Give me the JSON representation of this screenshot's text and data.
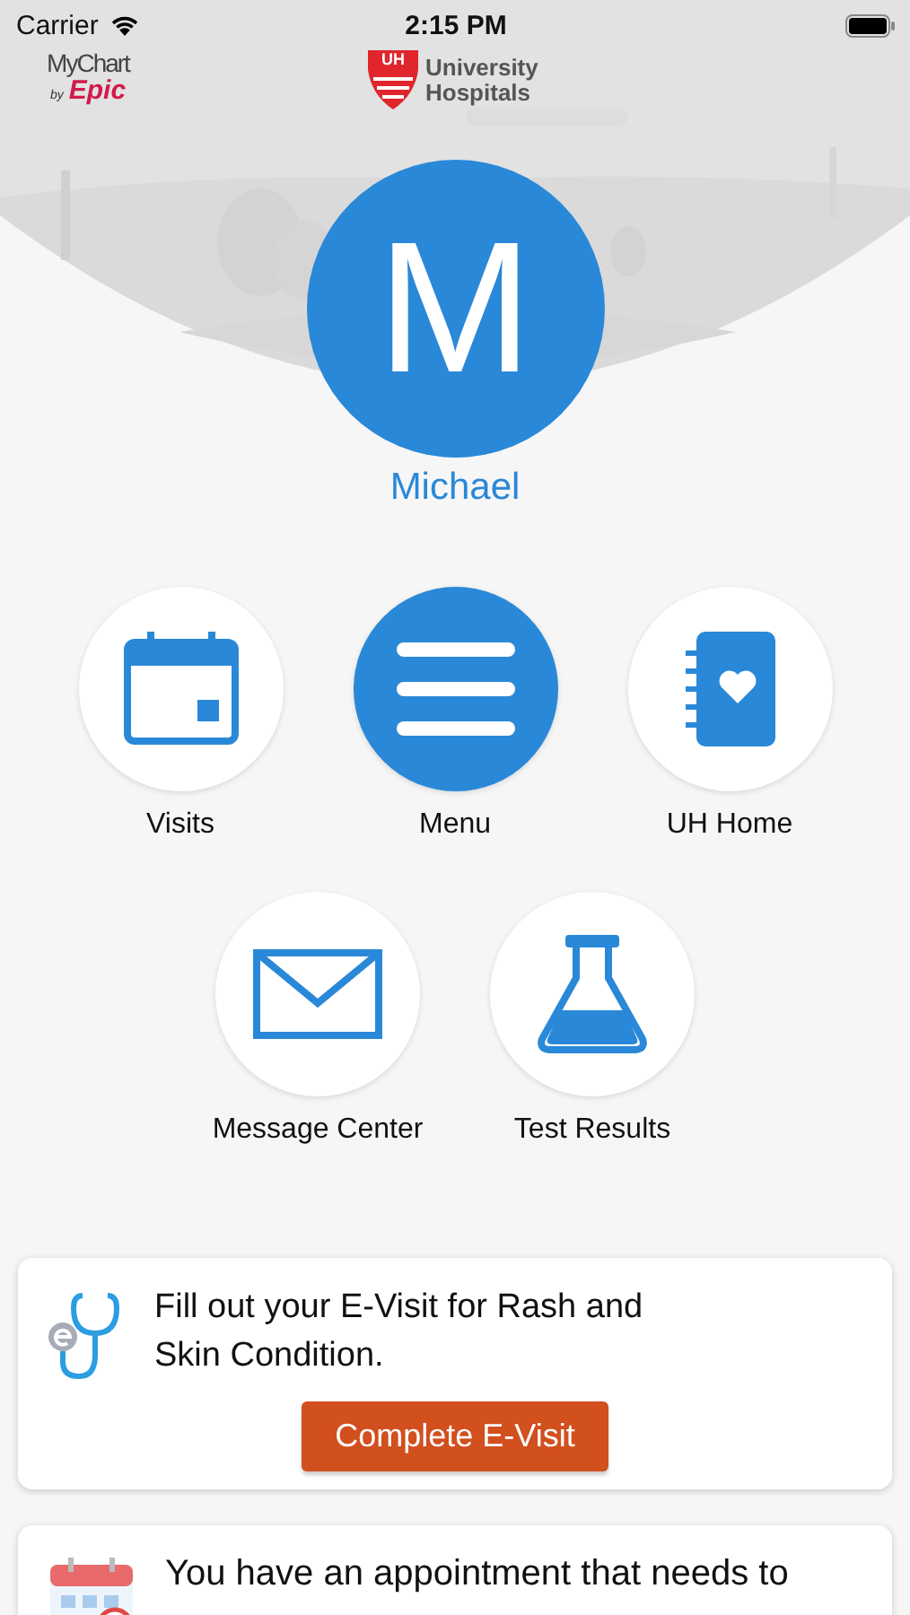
{
  "status_bar": {
    "carrier": "Carrier",
    "time": "2:15 PM"
  },
  "header": {
    "mychart_logo": {
      "name": "MyChart",
      "by": "by",
      "brand": "Epic"
    },
    "uh_logo": {
      "badge": "UH",
      "line_1": "University",
      "line_2": "Hospitals"
    }
  },
  "profile": {
    "initial": "M",
    "name": "Michael"
  },
  "shortcut_rows": [
    {
      "items": [
        {
          "label": "Visits",
          "kind": "calendar",
          "highlighted": false
        },
        {
          "label": "Menu",
          "kind": "menu",
          "highlighted": true
        },
        {
          "label": "UH Home",
          "kind": "notebook",
          "highlighted": false
        }
      ]
    },
    {
      "items": [
        {
          "label": "Message Center",
          "kind": "envelope",
          "highlighted": false
        },
        {
          "label": "Test Results",
          "kind": "flask",
          "highlighted": false
        }
      ]
    }
  ],
  "cards": [
    {
      "kind": "evisit",
      "text": "Fill out your E-Visit for Rash and Skin Condition.",
      "button": "Complete E-Visit"
    },
    {
      "kind": "appointment",
      "text": "You have an appointment that needs to"
    }
  ]
}
